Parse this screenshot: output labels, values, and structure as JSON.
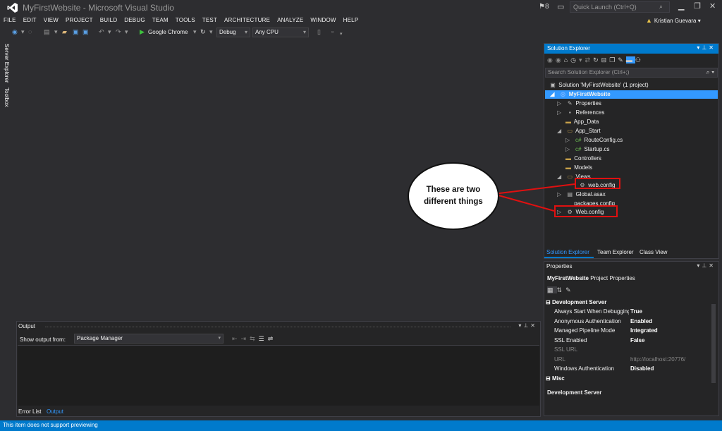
{
  "window": {
    "title": "MyFirstWebsite - Microsoft Visual Studio",
    "notification_count": "8",
    "quick_launch_placeholder": "Quick Launch (Ctrl+Q)",
    "user_name": "Kristian Guevara"
  },
  "menu": [
    "FILE",
    "EDIT",
    "VIEW",
    "PROJECT",
    "BUILD",
    "DEBUG",
    "TEAM",
    "TOOLS",
    "TEST",
    "ARCHITECTURE",
    "ANALYZE",
    "WINDOW",
    "HELP"
  ],
  "toolbar": {
    "run_target": "Google Chrome",
    "configuration": "Debug",
    "platform": "Any CPU"
  },
  "side_tabs": [
    "Server Explorer",
    "Toolbox"
  ],
  "solution_explorer": {
    "title": "Solution Explorer",
    "search_placeholder": "Search Solution Explorer (Ctrl+;)",
    "tree": [
      {
        "label": "Solution 'MyFirstWebsite' (1 project)",
        "icon": "solution-icon",
        "expanded": null
      },
      {
        "label": "MyFirstWebsite",
        "icon": "web-project-icon",
        "expanded": true,
        "selected": true
      },
      {
        "label": "Properties",
        "icon": "wrench-icon",
        "expanded": false
      },
      {
        "label": "References",
        "icon": "references-icon",
        "expanded": false
      },
      {
        "label": "App_Data",
        "icon": "folder-icon",
        "expanded": null
      },
      {
        "label": "App_Start",
        "icon": "folder-open-icon",
        "expanded": true
      },
      {
        "label": "RouteConfig.cs",
        "icon": "csharp-file-icon",
        "expanded": false
      },
      {
        "label": "Startup.cs",
        "icon": "csharp-file-icon",
        "expanded": false
      },
      {
        "label": "Controllers",
        "icon": "folder-icon",
        "expanded": null
      },
      {
        "label": "Models",
        "icon": "folder-icon",
        "expanded": null
      },
      {
        "label": "Views",
        "icon": "folder-open-icon",
        "expanded": true
      },
      {
        "label": "web.config",
        "icon": "config-file-icon",
        "expanded": null
      },
      {
        "label": "Global.asax",
        "icon": "asax-file-icon",
        "expanded": false
      },
      {
        "label": "packages.config",
        "icon": "config-file-icon",
        "expanded": null
      },
      {
        "label": "Web.config",
        "icon": "config-file-icon",
        "expanded": false
      }
    ],
    "tabs": [
      "Solution Explorer",
      "Team Explorer",
      "Class View"
    ],
    "active_tab": "Solution Explorer"
  },
  "properties": {
    "title": "Properties",
    "subject_name": "MyFirstWebsite",
    "subject_type": "Project Properties",
    "categories": [
      {
        "name": "Development Server",
        "rows": [
          {
            "key": "Always Start When Debugging",
            "value": "True",
            "dim": false
          },
          {
            "key": "Anonymous Authentication",
            "value": "Enabled",
            "dim": false
          },
          {
            "key": "Managed Pipeline Mode",
            "value": "Integrated",
            "dim": false
          },
          {
            "key": "SSL Enabled",
            "value": "False",
            "dim": false
          },
          {
            "key": "SSL URL",
            "value": "",
            "dim": true
          },
          {
            "key": "URL",
            "value": "http://localhost:20776/",
            "dim": true
          },
          {
            "key": "Windows Authentication",
            "value": "Disabled",
            "dim": false
          }
        ]
      },
      {
        "name": "Misc",
        "rows": []
      }
    ],
    "description_title": "Development Server"
  },
  "output": {
    "title": "Output",
    "show_from_label": "Show output from:",
    "source": "Package Manager",
    "tabs": [
      "Error List",
      "Output"
    ],
    "active_tab": "Output"
  },
  "status": {
    "message": "This item does not support previewing"
  },
  "annotation": {
    "text": "These are two different things",
    "highlight_color": "#e01010"
  },
  "colors": {
    "accent": "#007acc",
    "background": "#2d2d30",
    "panel": "#252526",
    "selection": "#3399ff"
  }
}
